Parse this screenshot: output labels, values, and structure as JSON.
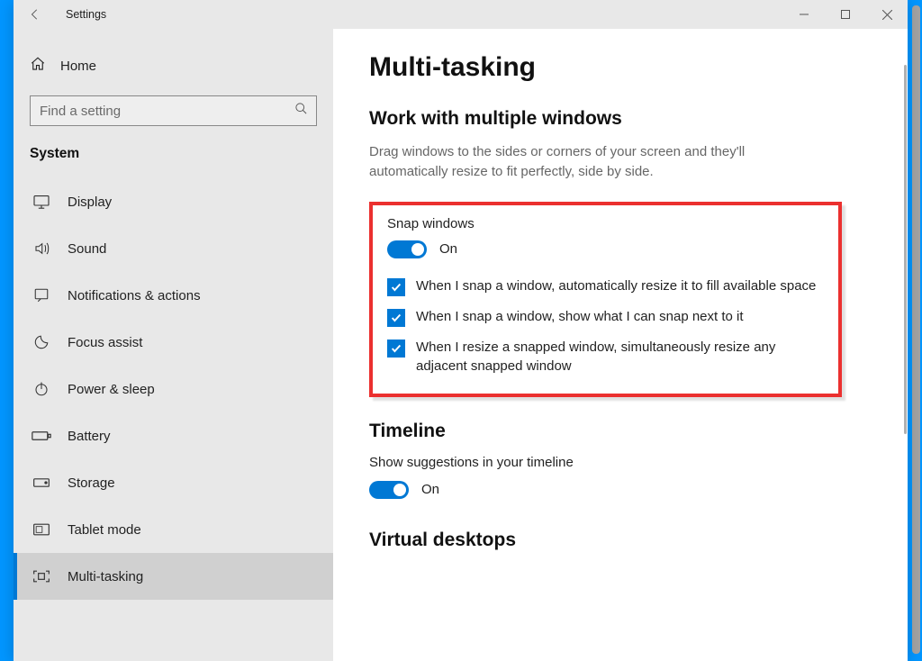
{
  "window": {
    "title": "Settings"
  },
  "sidebar": {
    "home": "Home",
    "search_placeholder": "Find a setting",
    "category": "System",
    "items": [
      {
        "label": "Display"
      },
      {
        "label": "Sound"
      },
      {
        "label": "Notifications & actions"
      },
      {
        "label": "Focus assist"
      },
      {
        "label": "Power & sleep"
      },
      {
        "label": "Battery"
      },
      {
        "label": "Storage"
      },
      {
        "label": "Tablet mode"
      },
      {
        "label": "Multi-tasking"
      }
    ]
  },
  "main": {
    "title": "Multi-tasking",
    "section_multi": {
      "heading": "Work with multiple windows",
      "desc": "Drag windows to the sides or corners of your screen and they'll automatically resize to fit perfectly, side by side.",
      "snap_label": "Snap windows",
      "snap_state": "On",
      "check1": "When I snap a window, automatically resize it to fill available space",
      "check2": "When I snap a window, show what I can snap next to it",
      "check3": "When I resize a snapped window, simultaneously resize any adjacent snapped window"
    },
    "section_timeline": {
      "heading": "Timeline",
      "label": "Show suggestions in your timeline",
      "state": "On"
    },
    "section_vdesk": {
      "heading": "Virtual desktops"
    }
  }
}
